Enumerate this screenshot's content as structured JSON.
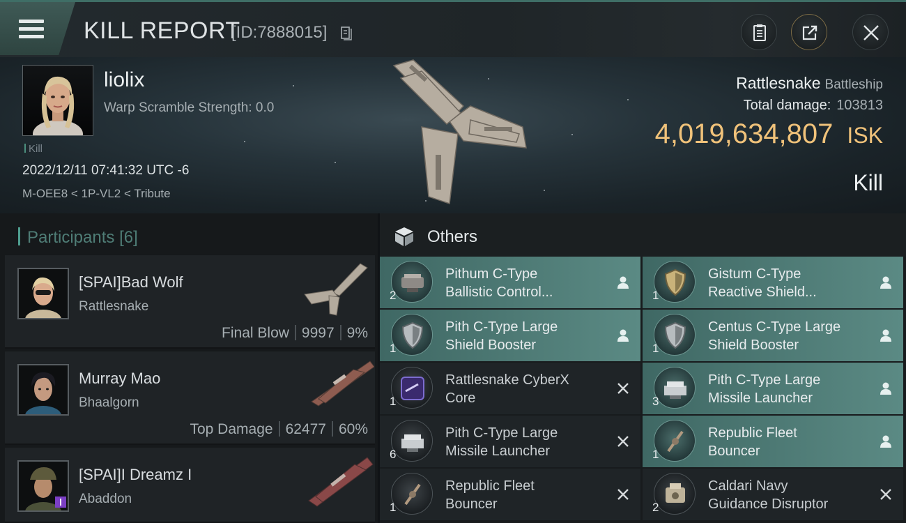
{
  "header": {
    "title": "KILL REPORT",
    "report_id": "[ID:7888015]",
    "accent": "#3f6e66"
  },
  "victim": {
    "name": "liolix",
    "warp_scramble": "Warp Scramble Strength: 0.0",
    "tag": "Kill",
    "datetime": "2022/12/11 07:41:32 UTC -6",
    "location": "M-OEE8 < 1P-VL2 < Tribute"
  },
  "ship": {
    "name": "Rattlesnake",
    "class": "Battleship",
    "total_damage_label": "Total damage:",
    "total_damage": "103813",
    "isk_value": "4,019,634,807",
    "isk_unit": "ISK",
    "result": "Kill",
    "isk_color": "#f0c27a"
  },
  "participants": {
    "label": "Participants",
    "count": "[6]",
    "rows": [
      {
        "name": "[SPAI]Bad Wolf",
        "ship": "Rattlesnake",
        "role": "Final Blow",
        "damage": "9997",
        "percent": "9%"
      },
      {
        "name": "Murray Mao",
        "ship": "Bhaalgorn",
        "role": "Top Damage",
        "damage": "62477",
        "percent": "60%"
      },
      {
        "name": "[SPAI]I Dreamz I",
        "ship": "Abaddon",
        "role": "",
        "damage": "",
        "percent": ""
      }
    ]
  },
  "others": {
    "label": "Others",
    "items": [
      {
        "qty": "2",
        "line1": "Pithum C-Type",
        "line2": "Ballistic Control...",
        "status": "dropped",
        "icon": "ballistic-control-icon"
      },
      {
        "qty": "1",
        "line1": "Gistum C-Type",
        "line2": "Reactive Shield...",
        "status": "dropped",
        "icon": "shield-hardener-icon"
      },
      {
        "qty": "1",
        "line1": "Pith C-Type Large",
        "line2": "Shield Booster",
        "status": "dropped",
        "icon": "shield-booster-icon"
      },
      {
        "qty": "1",
        "line1": "Centus C-Type Large",
        "line2": "Shield Booster",
        "status": "dropped",
        "icon": "shield-booster-icon"
      },
      {
        "qty": "1",
        "line1": "Rattlesnake CyberX",
        "line2": "Core",
        "status": "destroyed",
        "icon": "cyberx-core-icon"
      },
      {
        "qty": "3",
        "line1": "Pith C-Type Large",
        "line2": "Missile Launcher",
        "status": "dropped",
        "icon": "missile-launcher-icon"
      },
      {
        "qty": "6",
        "line1": "Pith C-Type Large",
        "line2": "Missile Launcher",
        "status": "destroyed",
        "icon": "missile-launcher-icon"
      },
      {
        "qty": "1",
        "line1": "Republic Fleet",
        "line2": "Bouncer",
        "status": "dropped",
        "icon": "drone-icon"
      },
      {
        "qty": "1",
        "line1": "Republic Fleet",
        "line2": "Bouncer",
        "status": "destroyed",
        "icon": "drone-icon"
      },
      {
        "qty": "2",
        "line1": "Caldari Navy",
        "line2": "Guidance Disruptor",
        "status": "destroyed",
        "icon": "guidance-disruptor-icon"
      }
    ]
  }
}
